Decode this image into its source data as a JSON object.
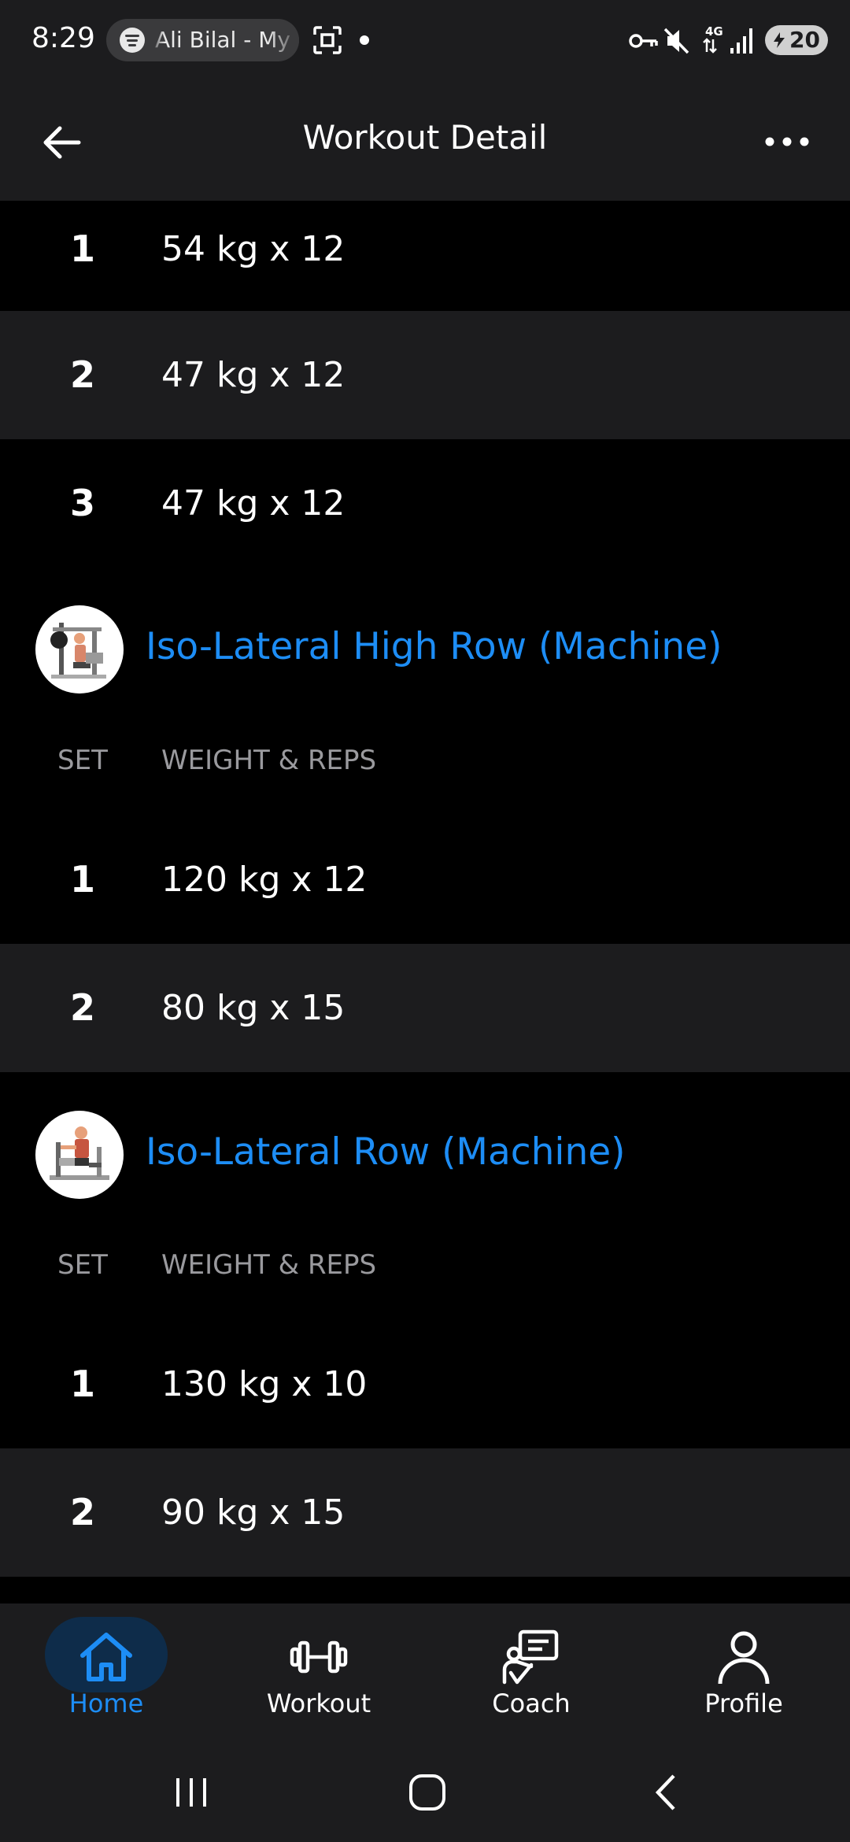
{
  "status_bar": {
    "time": "8:29",
    "media_text": "Ali Bilal - My",
    "battery": "20",
    "icons": [
      "spotify-icon",
      "screenshot-icon",
      "dot-icon",
      "vpn-key-icon",
      "mute-icon",
      "4g-icon",
      "signal-icon",
      "battery-icon"
    ]
  },
  "header": {
    "title": "Workout Detail",
    "back_icon": "arrow-left-icon",
    "more_icon": "more-horizontal-icon"
  },
  "top_sets": [
    {
      "set": "1",
      "value": "54 kg x 12"
    },
    {
      "set": "2",
      "value": "47 kg x 12"
    },
    {
      "set": "3",
      "value": "47 kg x 12"
    }
  ],
  "exercises": [
    {
      "name": "Iso-Lateral High Row (Machine)",
      "col_set": "SET",
      "col_weight_reps": "WEIGHT & REPS",
      "sets": [
        {
          "set": "1",
          "value": "120 kg x 12"
        },
        {
          "set": "2",
          "value": "80 kg x 15"
        }
      ]
    },
    {
      "name": "Iso-Lateral Row (Machine)",
      "col_set": "SET",
      "col_weight_reps": "WEIGHT & REPS",
      "sets": [
        {
          "set": "1",
          "value": "130 kg x 10"
        },
        {
          "set": "2",
          "value": "90 kg x 15"
        }
      ]
    }
  ],
  "bottom_nav": [
    {
      "label": "Home",
      "icon": "home-icon",
      "active": true
    },
    {
      "label": "Workout",
      "icon": "dumbbell-icon",
      "active": false
    },
    {
      "label": "Coach",
      "icon": "coach-icon",
      "active": false
    },
    {
      "label": "Profile",
      "icon": "profile-icon",
      "active": false
    }
  ],
  "colors": {
    "accent": "#1d8df5",
    "surface": "#1c1c1e",
    "background": "#000000",
    "muted_text": "#9a9a9e"
  }
}
